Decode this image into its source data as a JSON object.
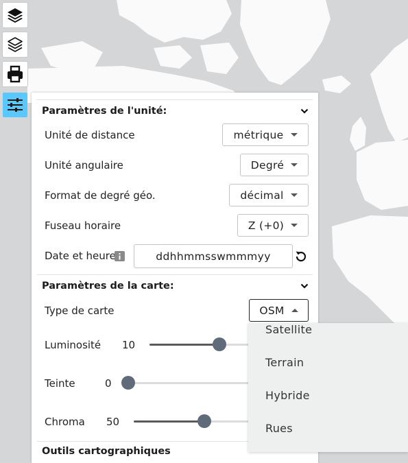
{
  "colors": {
    "map_land": "#fafafa",
    "map_water": "#d4d6d8",
    "active_tool": "#5ac8fa",
    "slider_thumb": "#5f6b78"
  },
  "toolbar": {
    "items": [
      {
        "icon": "layers-filled-icon"
      },
      {
        "icon": "layers-outline-icon"
      },
      {
        "icon": "print-icon"
      },
      {
        "icon": "settings-sliders-icon",
        "active": true
      }
    ]
  },
  "unit_settings": {
    "title": "Paramètres de l'unité:",
    "distance": {
      "label": "Unité de distance",
      "value": "métrique"
    },
    "angular": {
      "label": "Unité angulaire",
      "value": "Degré"
    },
    "geo_format": {
      "label": "Format de degré géo.",
      "value": "décimal"
    },
    "timezone": {
      "label": "Fuseau horaire",
      "value": "Z (+0)"
    },
    "datetime": {
      "label": "Date et heure",
      "value": "ddhhmmsswmmmyy"
    }
  },
  "map_settings": {
    "title": "Paramètres de la carte:",
    "map_type": {
      "label": "Type de carte",
      "value": "OSM"
    },
    "brightness": {
      "label": "Luminosité",
      "value": "10",
      "fraction": 0.8
    },
    "hue": {
      "label": "Teinte",
      "value": "0",
      "fraction": 0.0
    },
    "chroma": {
      "label": "Chroma",
      "value": "50",
      "fraction": 0.6
    }
  },
  "map_type_menu": {
    "options": [
      "Satellite",
      "Terrain",
      "Hybride",
      "Rues"
    ]
  },
  "next_section": {
    "title": "Outils cartographiques"
  }
}
